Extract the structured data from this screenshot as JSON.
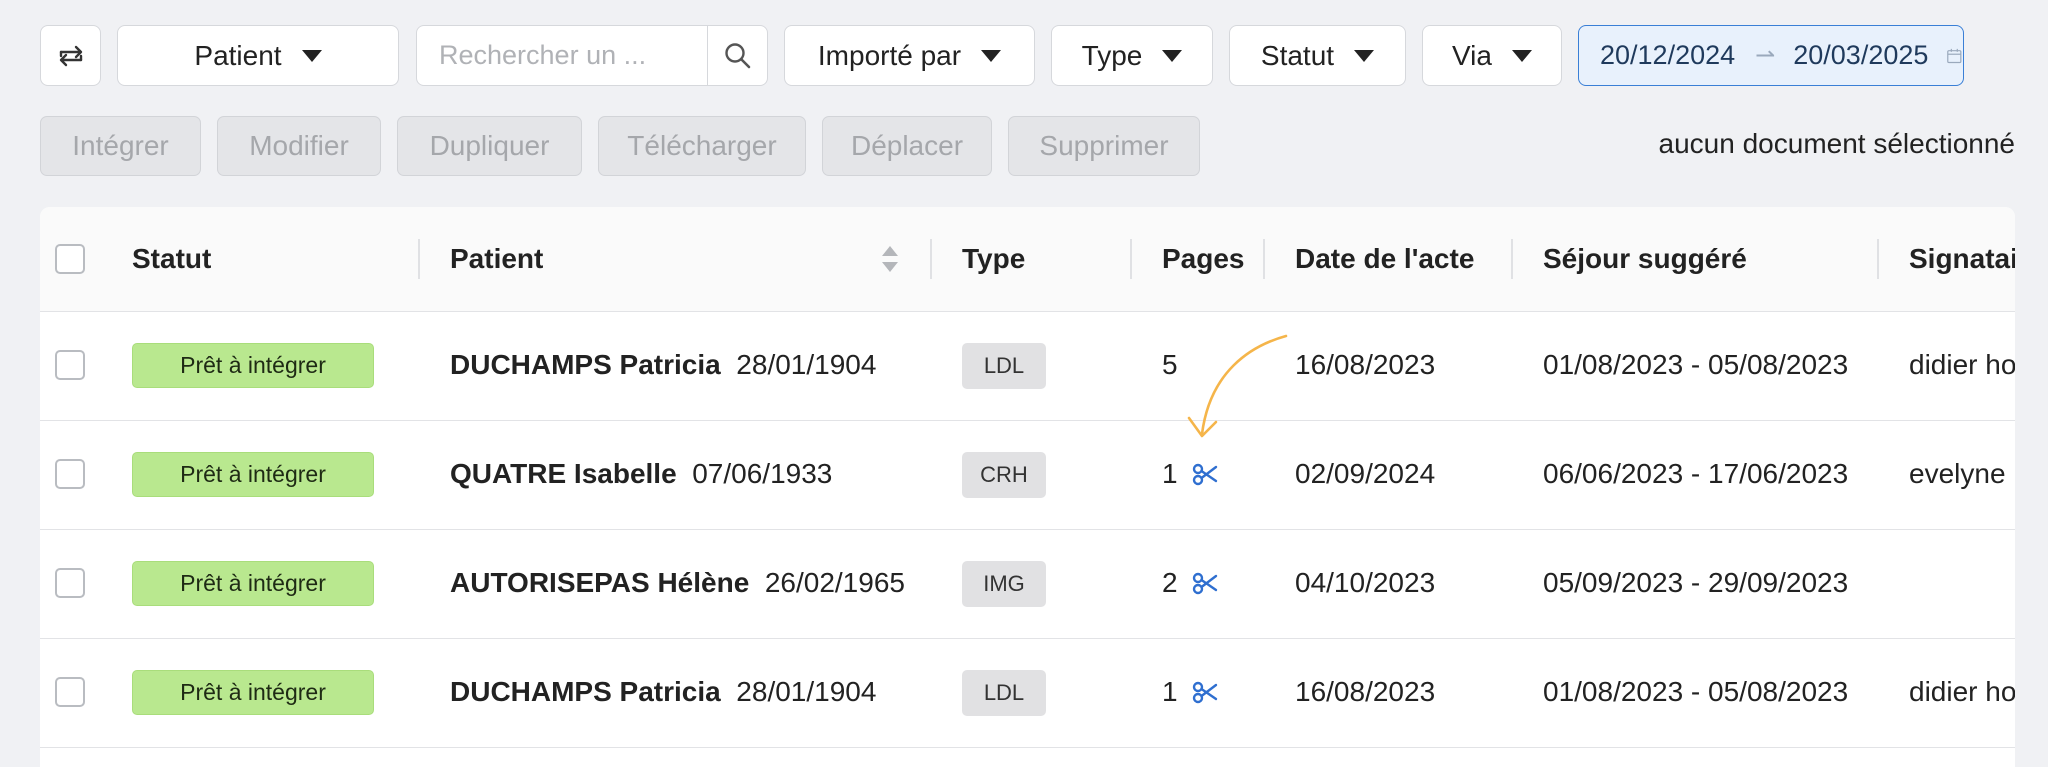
{
  "filters": {
    "patient": "Patient",
    "search_placeholder": "Rechercher un ...",
    "imported_by": "Importé par",
    "type": "Type",
    "status": "Statut",
    "via": "Via",
    "date_from": "20/12/2024",
    "date_to": "20/03/2025"
  },
  "actions": {
    "integrate": "Intégrer",
    "edit": "Modifier",
    "duplicate": "Dupliquer",
    "download": "Télécharger",
    "move": "Déplacer",
    "delete": "Supprimer",
    "selection_status": "aucun document sélectionné"
  },
  "table": {
    "headers": {
      "status": "Statut",
      "patient": "Patient",
      "type": "Type",
      "pages": "Pages",
      "act_date": "Date de l'acte",
      "stay": "Séjour suggéré",
      "signatory": "Signatai"
    },
    "rows": [
      {
        "status": "Prêt à intégrer",
        "patient_name": "DUCHAMPS Patricia",
        "birth_date": "28/01/1904",
        "type": "LDL",
        "pages": "5",
        "act_date": "16/08/2023",
        "stay": "01/08/2023 - 05/08/2023",
        "signatory": "didier ho"
      },
      {
        "status": "Prêt à intégrer",
        "patient_name": "QUATRE Isabelle",
        "birth_date": "07/06/1933",
        "type": "CRH",
        "pages": "1",
        "act_date": "02/09/2024",
        "stay": "06/06/2023 - 17/06/2023",
        "signatory": "evelyne p"
      },
      {
        "status": "Prêt à intégrer",
        "patient_name": "AUTORISEPAS Hélène",
        "birth_date": "26/02/1965",
        "type": "IMG",
        "pages": "2",
        "act_date": "04/10/2023",
        "stay": "05/09/2023 - 29/09/2023",
        "signatory": ""
      },
      {
        "status": "Prêt à intégrer",
        "patient_name": "DUCHAMPS Patricia",
        "birth_date": "28/01/1904",
        "type": "LDL",
        "pages": "1",
        "act_date": "16/08/2023",
        "stay": "01/08/2023 - 05/08/2023",
        "signatory": "didier ho"
      }
    ]
  },
  "colors": {
    "accent": "#2f6fd0",
    "badge_green": "#b9e88f",
    "annotation_arrow": "#f5b54a"
  }
}
